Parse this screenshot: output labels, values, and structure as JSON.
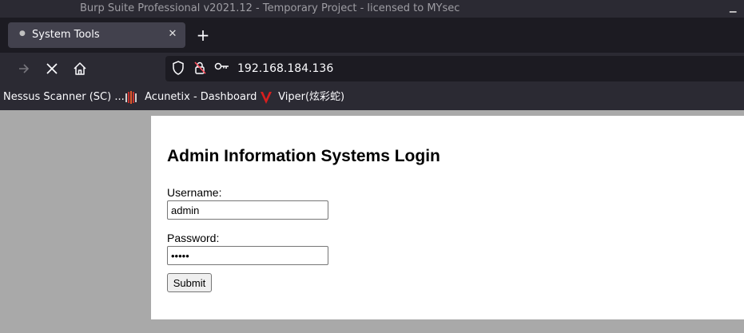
{
  "window": {
    "title": "Burp Suite Professional v2021.12 - Temporary Project - licensed to MYsec"
  },
  "tabs": [
    {
      "label": "System Tools",
      "active": true
    }
  ],
  "navbar": {
    "url": "192.168.184.136"
  },
  "bookmarks": [
    {
      "label": "Nessus Scanner (SC) ..."
    },
    {
      "label": "Acunetix - Dashboard"
    },
    {
      "label": "Viper(炫彩蛇)"
    }
  ],
  "page": {
    "heading": "Admin Information Systems Login",
    "username_label": "Username:",
    "username_value": "admin",
    "password_label": "Password:",
    "password_value": "admin",
    "submit_label": "Submit"
  },
  "colors": {
    "chrome_dark": "#2b2a33",
    "tab_strip": "#1c1b22",
    "active_tab": "#42414d",
    "page_background": "#a9a9a9",
    "viper_red": "#d81e1e"
  }
}
